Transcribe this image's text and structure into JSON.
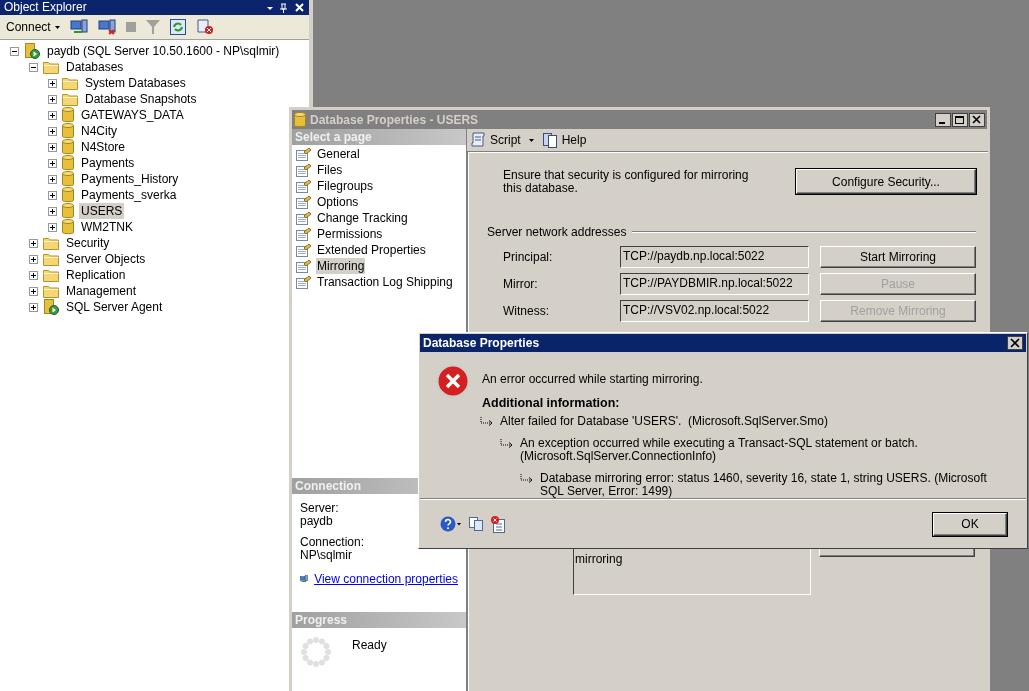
{
  "object_explorer": {
    "title": "Object Explorer",
    "toolbar": {
      "connect": "Connect"
    },
    "tree": [
      {
        "label": "paydb (SQL Server 10.50.1600 - NP\\sqlmir)",
        "kind": "server",
        "expanded": true,
        "selected": false,
        "children": [
          {
            "label": "Databases",
            "kind": "folder",
            "expanded": true,
            "selected": false,
            "children": [
              {
                "label": "System Databases",
                "kind": "folder",
                "expanded": false,
                "selected": false
              },
              {
                "label": "Database Snapshots",
                "kind": "folder",
                "expanded": false,
                "selected": false
              },
              {
                "label": "GATEWAYS_DATA",
                "kind": "database",
                "expanded": false,
                "selected": false
              },
              {
                "label": "N4City",
                "kind": "database",
                "expanded": false,
                "selected": false
              },
              {
                "label": "N4Store",
                "kind": "database",
                "expanded": false,
                "selected": false
              },
              {
                "label": "Payments",
                "kind": "database",
                "expanded": false,
                "selected": false
              },
              {
                "label": "Payments_History",
                "kind": "database",
                "expanded": false,
                "selected": false
              },
              {
                "label": "Payments_sverka",
                "kind": "database",
                "expanded": false,
                "selected": false
              },
              {
                "label": "USERS",
                "kind": "database",
                "expanded": false,
                "selected": true
              },
              {
                "label": "WM2TNK",
                "kind": "database",
                "expanded": false,
                "selected": false
              }
            ]
          },
          {
            "label": "Security",
            "kind": "folder",
            "expanded": false,
            "selected": false
          },
          {
            "label": "Server Objects",
            "kind": "folder",
            "expanded": false,
            "selected": false
          },
          {
            "label": "Replication",
            "kind": "folder",
            "expanded": false,
            "selected": false
          },
          {
            "label": "Management",
            "kind": "folder",
            "expanded": false,
            "selected": false
          },
          {
            "label": "SQL Server Agent",
            "kind": "agent",
            "expanded": false,
            "selected": false
          }
        ]
      }
    ]
  },
  "properties_window": {
    "title": "Database Properties - USERS",
    "select_page_header": "Select a page",
    "pages": [
      {
        "label": "General",
        "selected": false
      },
      {
        "label": "Files",
        "selected": false
      },
      {
        "label": "Filegroups",
        "selected": false
      },
      {
        "label": "Options",
        "selected": false
      },
      {
        "label": "Change Tracking",
        "selected": false
      },
      {
        "label": "Permissions",
        "selected": false
      },
      {
        "label": "Extended Properties",
        "selected": false
      },
      {
        "label": "Mirroring",
        "selected": true
      },
      {
        "label": "Transaction Log Shipping",
        "selected": false
      }
    ],
    "toolbar": {
      "script": "Script",
      "help": "Help"
    },
    "security_note": "Ensure that security is configured for mirroring this database.",
    "configure_button": "Configure Security...",
    "addresses_header": "Server network addresses",
    "addresses": [
      {
        "label": "Principal:",
        "value": "TCP://paydb.np.local:5022",
        "button": "Start Mirroring",
        "disabled": false
      },
      {
        "label": "Mirror:",
        "value": "TCP://PAYDBMIR.np.local:5022",
        "button": "Pause",
        "disabled": true
      },
      {
        "label": "Witness:",
        "value": "TCP://VSV02.np.local:5022",
        "button": "Remove Mirroring",
        "disabled": true
      }
    ],
    "status_text": "mirroring",
    "connection_header": "Connection",
    "connection": [
      {
        "label": "Server:",
        "value": "paydb"
      },
      {
        "label": "Connection:",
        "value": "NP\\sqlmir"
      }
    ],
    "connection_link": "View connection properties",
    "progress_header": "Progress",
    "progress_status": "Ready"
  },
  "error_dialog": {
    "title": "Database Properties",
    "message": "An error occurred while starting mirroring.",
    "additional_header": "Additional information:",
    "details": [
      {
        "text": "Alter failed for Database 'USERS'.  (Microsoft.SqlServer.Smo)",
        "children": [
          {
            "text": "An exception occurred while executing a Transact-SQL statement or batch. (Microsoft.SqlServer.ConnectionInfo)",
            "children": [
              {
                "text": "Database mirroring error: status 1460, severity 16, state 1, string USERS. (Microsoft SQL Server, Error: 1499)"
              }
            ]
          }
        ]
      }
    ],
    "ok_button": "OK"
  }
}
